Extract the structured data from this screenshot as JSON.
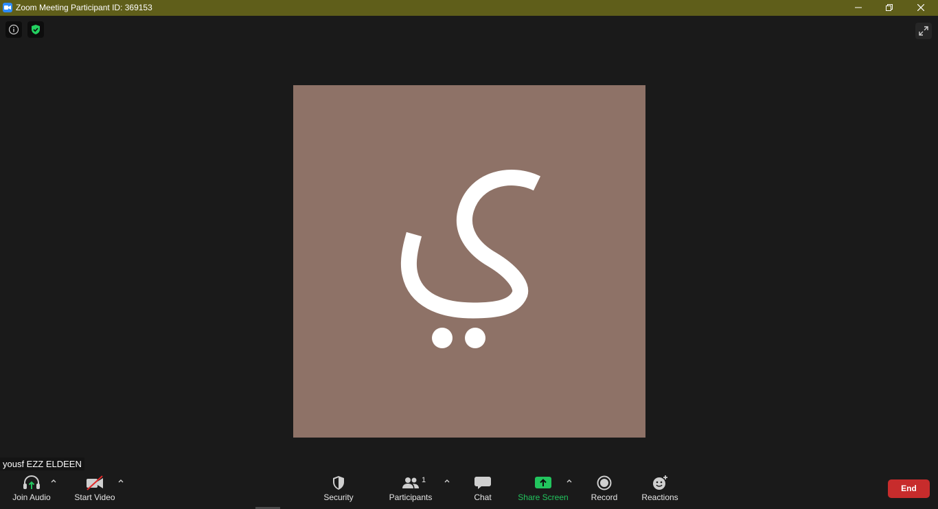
{
  "window": {
    "title": "Zoom Meeting Participant ID: 369153"
  },
  "colors": {
    "titlebar": "#5f5e1a",
    "background": "#1a1a1a",
    "tile": "#8e7267",
    "share_green": "#22c55e",
    "end_red": "#c72c2c",
    "shield_green": "#23d160"
  },
  "video": {
    "avatar_letter": "ي"
  },
  "participant": {
    "name": "yousf EZZ ELDEEN"
  },
  "toolbar": {
    "join_audio": "Join Audio",
    "start_video": "Start Video",
    "security": "Security",
    "participants": "Participants",
    "participants_count": "1",
    "chat": "Chat",
    "share_screen": "Share Screen",
    "record": "Record",
    "reactions": "Reactions",
    "end": "End"
  },
  "icons": {
    "app": "zoom-camera-icon",
    "info": "info-icon",
    "encryption": "shield-check-icon",
    "fullscreen": "expand-icon",
    "audio": "headphones-arrow-icon",
    "video": "camera-off-icon",
    "security": "shield-icon",
    "participants": "people-icon",
    "chat": "chat-bubble-icon",
    "share": "share-arrow-icon",
    "record": "record-icon",
    "reactions": "smiley-plus-icon"
  }
}
